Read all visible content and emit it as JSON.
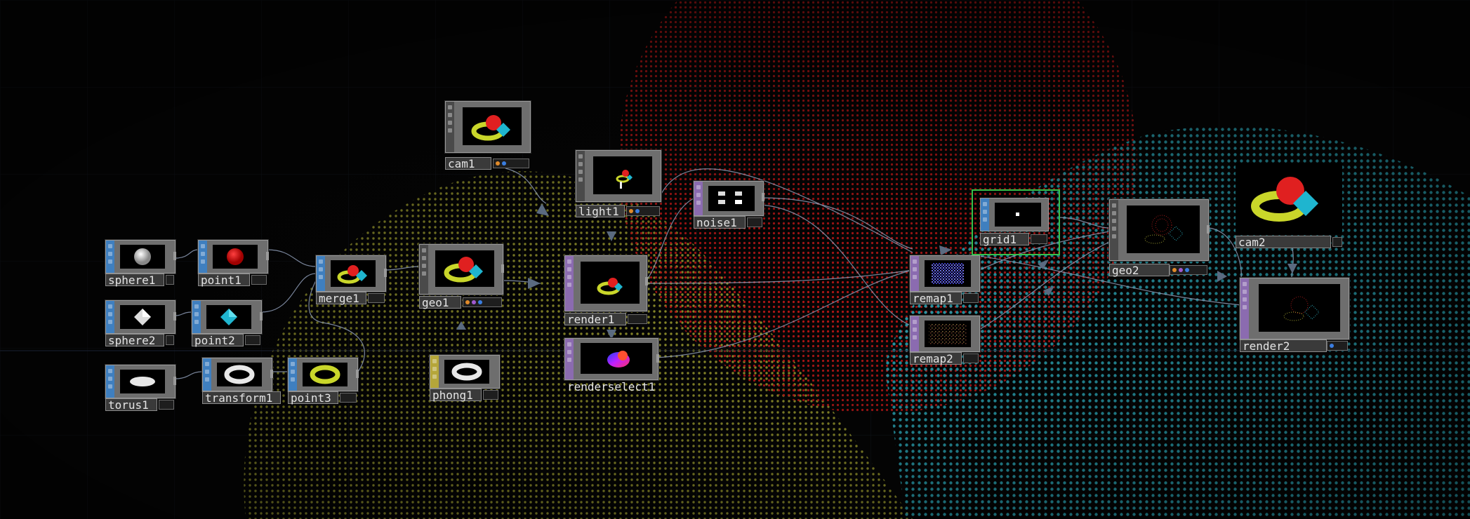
{
  "window": {
    "title": "",
    "background_color": "#050505"
  },
  "colors": {
    "sop_strip": "#3f7fbf",
    "top_strip": "#8b6bb0",
    "comp_strip": "#4a4a4a",
    "mat_strip": "#b5a63a",
    "wire": "#8d9bb5",
    "selected": "#35c04a",
    "dots_red": "#c41818",
    "dots_yellow": "#b8b83a",
    "dots_cyan": "#2fb8c8"
  },
  "nodes": [
    {
      "id": "sphere1",
      "label": "sphere1",
      "family": "SOP",
      "strip": "blue",
      "preview_icon": "white-sphere-icon"
    },
    {
      "id": "point1",
      "label": "point1",
      "family": "SOP",
      "strip": "blue",
      "preview_icon": "red-sphere-icon"
    },
    {
      "id": "sphere2",
      "label": "sphere2",
      "family": "SOP",
      "strip": "blue",
      "preview_icon": "white-diamond-icon"
    },
    {
      "id": "point2",
      "label": "point2",
      "family": "SOP",
      "strip": "blue",
      "preview_icon": "cyan-diamond-icon"
    },
    {
      "id": "torus1",
      "label": "torus1",
      "family": "SOP",
      "strip": "blue",
      "preview_icon": "white-capsule-icon"
    },
    {
      "id": "transform1",
      "label": "transform1",
      "family": "SOP",
      "strip": "blue",
      "preview_icon": "white-torus-icon"
    },
    {
      "id": "point3",
      "label": "point3",
      "family": "SOP",
      "strip": "blue",
      "preview_icon": "yellow-torus-icon"
    },
    {
      "id": "merge1",
      "label": "merge1",
      "family": "SOP",
      "strip": "blue",
      "preview_icon": "merged-shapes-icon"
    },
    {
      "id": "geo1",
      "label": "geo1",
      "family": "COMP",
      "strip": "gray",
      "preview_icon": "merged-shapes-icon"
    },
    {
      "id": "cam1",
      "label": "cam1",
      "family": "COMP",
      "strip": "gray",
      "preview_icon": "merged-shapes-icon"
    },
    {
      "id": "light1",
      "label": "light1",
      "family": "COMP",
      "strip": "gray",
      "preview_icon": "small-shapes-icon"
    },
    {
      "id": "phong1",
      "label": "phong1",
      "family": "MAT",
      "strip": "yellow",
      "preview_icon": "white-torus-icon"
    },
    {
      "id": "render1",
      "label": "render1",
      "family": "TOP",
      "strip": "purple",
      "preview_icon": "rendered-shapes-icon"
    },
    {
      "id": "renderselect1",
      "label": "renderselect1",
      "family": "TOP",
      "strip": "purple",
      "preview_icon": "gradient-blob-icon"
    },
    {
      "id": "noise1",
      "label": "noise1",
      "family": "TOP",
      "strip": "purple",
      "preview_icon": "noise-text-icon"
    },
    {
      "id": "remap1",
      "label": "remap1",
      "family": "TOP",
      "strip": "purple",
      "preview_icon": "blue-noise-icon"
    },
    {
      "id": "remap2",
      "label": "remap2",
      "family": "TOP",
      "strip": "purple",
      "preview_icon": "dark-noise-icon"
    },
    {
      "id": "grid1",
      "label": "grid1",
      "family": "SOP",
      "strip": "blue",
      "preview_icon": "grid-dot-icon",
      "selected": true
    },
    {
      "id": "geo2",
      "label": "geo2",
      "family": "COMP",
      "strip": "gray",
      "preview_icon": "particles-icon"
    },
    {
      "id": "cam2",
      "label": "cam2",
      "family": "COMP",
      "strip": "gray",
      "preview_icon": "merged-shapes-icon"
    },
    {
      "id": "render2",
      "label": "render2",
      "family": "TOP",
      "strip": "purple",
      "preview_icon": "particles-icon"
    }
  ],
  "node_flags": {
    "cam1": [
      "#e08a2a",
      "#3a7de0"
    ],
    "light1": [
      "#e08a2a",
      "#3a7de0"
    ],
    "geo1": [
      "#e08a2a",
      "#a05ad0",
      "#3a7de0"
    ],
    "geo2": [
      "#e08a2a",
      "#a05ad0",
      "#3a7de0"
    ],
    "render2": [
      "#3a7de0"
    ]
  }
}
